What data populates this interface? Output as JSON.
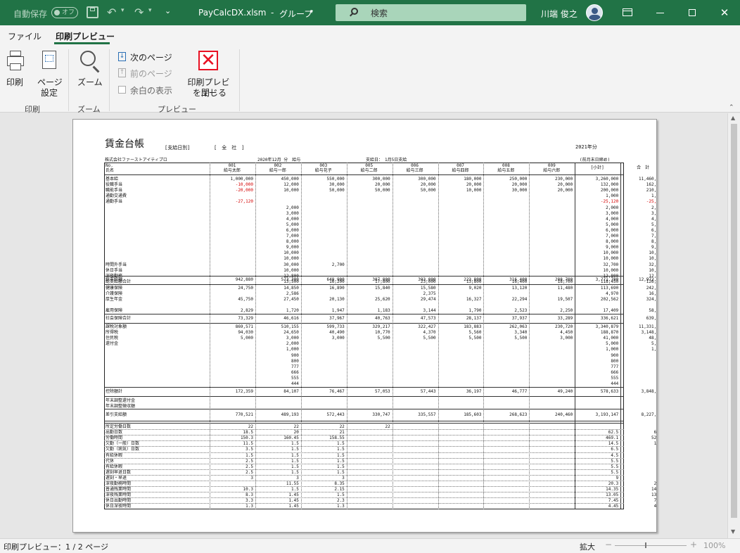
{
  "titlebar": {
    "autosave_label": "自動保存",
    "autosave_toggle": "オフ",
    "filename": "PayCalcDX.xlsm",
    "separator": "-",
    "group": "グループ",
    "search_placeholder": "検索",
    "user_name": "川端 俊之"
  },
  "tabs": [
    {
      "label": "ファイル"
    },
    {
      "label": "印刷プレビュー"
    }
  ],
  "ribbon": {
    "print": "印刷",
    "page_setup": [
      "ページ",
      "設定"
    ],
    "zoom": "ズーム",
    "next_page": "次のページ",
    "prev_page": "前のページ",
    "show_margins": "余白の表示",
    "close_preview": [
      "印刷プレビュー",
      "を閉じる"
    ],
    "groups": [
      "印刷",
      "ズーム",
      "プレビュー"
    ]
  },
  "status": {
    "text": "印刷プレビュー：1 / 2 ページ",
    "zoom_label": "拡大",
    "zoom_percent": "100%",
    "zoom_minus": "−",
    "zoom_plus": "+",
    "zoom_fraction": 0.42
  },
  "sheet": {
    "title": "賃金台帳",
    "mode": "[支給日別]",
    "scope": "[　全　社　]",
    "year": "2021年分",
    "company": "株式会社ファーストアイティプロ",
    "period": "2020年12月 分　給与",
    "pay_date": "支給日：　1月5日支給",
    "note": "(前月末日締め)",
    "hdr_no": "No.",
    "hdr_name": "氏名",
    "subtotal_label": "[小計]",
    "total_label": "合　計",
    "employees": [
      {
        "no": "001",
        "name": "給与太郎"
      },
      {
        "no": "002",
        "name": "給与一郎"
      },
      {
        "no": "003",
        "name": "給与花子"
      },
      {
        "no": "005",
        "name": "給与二郎"
      },
      {
        "no": "006",
        "name": "給与三郎"
      },
      {
        "no": "007",
        "name": "給与四郎"
      },
      {
        "no": "008",
        "name": "給与五郎"
      },
      {
        "no": "009",
        "name": "給与六郎"
      }
    ],
    "earn_labels": [
      "基本給",
      "役職手当",
      "職能手当",
      "通勤交通費",
      "通勤手当",
      "",
      "",
      "",
      "",
      "",
      "",
      "",
      "",
      "",
      "",
      "時間外手当",
      "休日手当",
      "深夜勤務",
      "総支給額合計"
    ],
    "earn_cols": [
      [
        "1,000,000",
        "-10,000",
        "-20,000",
        "",
        "-27,120",
        "",
        "",
        "",
        "",
        "",
        "",
        "",
        "",
        "",
        "",
        "",
        "",
        "",
        ""
      ],
      [
        "450,000",
        "12,000",
        "10,000",
        "",
        "",
        "2,000",
        "3,000",
        "4,000",
        "5,000",
        "6,000",
        "7,000",
        "8,000",
        "9,000",
        "10,000",
        "10,000",
        "30,000",
        "10,000",
        "12,800",
        "13,500"
      ],
      [
        "550,000",
        "30,000",
        "50,000",
        "",
        "",
        "",
        "",
        "",
        "",
        "",
        "",
        "",
        "",
        "",
        "",
        "2,700",
        "",
        "",
        "16,200"
      ],
      [
        "300,000",
        "20,000",
        "50,000",
        "",
        "",
        "",
        "",
        "",
        "",
        "",
        "",
        "",
        "",
        "",
        "",
        "",
        "",
        "",
        "17,800"
      ],
      [
        "300,000",
        "20,000",
        "50,000",
        "",
        "",
        "",
        "",
        "",
        "",
        "",
        "",
        "",
        "",
        "",
        "",
        "",
        "",
        "",
        "23,000"
      ],
      [
        "180,000",
        "20,000",
        "10,000",
        "",
        "",
        "",
        "",
        "",
        "",
        "",
        "",
        "",
        "",
        "",
        "",
        "",
        "",
        "",
        "13,800"
      ],
      [
        "250,000",
        "20,000",
        "30,000",
        "",
        "",
        "",
        "",
        "",
        "",
        "",
        "",
        "",
        "",
        "",
        "",
        "",
        "",
        "",
        "16,400"
      ],
      [
        "230,000",
        "20,000",
        "20,000",
        "",
        "",
        "",
        "",
        "",
        "",
        "",
        "",
        "",
        "",
        "",
        "",
        "",
        "",
        "",
        "18,700"
      ],
      [
        "3,260,000",
        "132,000",
        "200,000",
        "1,000",
        "-25,120",
        "2,000",
        "3,000",
        "4,000",
        "5,000",
        "6,000",
        "7,000",
        "8,000",
        "9,000",
        "10,000",
        "10,000",
        "32,700",
        "10,000",
        "12,800",
        "118,450"
      ],
      [
        "11,460,000",
        "162,000",
        "210,000",
        "1,000",
        "-25,120",
        "2,000",
        "3,000",
        "4,000",
        "5,000",
        "6,000",
        "7,000",
        "8,000",
        "9,000",
        "10,000",
        "10,000",
        "32,700",
        "10,000",
        "12,800",
        "126,350"
      ]
    ],
    "gross": {
      "label": "総支給額",
      "values": [
        "942,880",
        "573,300",
        "648,900",
        "387,800",
        "393,000",
        "223,800",
        "316,400",
        "288,700",
        "3,771,780",
        "12,972,730"
      ]
    },
    "ins_labels": [
      "健康保険",
      "介護保険",
      "厚生年金",
      "",
      "雇用保険"
    ],
    "ins_cols": [
      [
        "24,750",
        "",
        "45,750",
        "",
        "2,829"
      ],
      [
        "14,850",
        "2,586",
        "27,450",
        "",
        "1,720"
      ],
      [
        "16,890",
        "",
        "20,130",
        "",
        "1,947"
      ],
      [
        "15,840",
        "",
        "25,620",
        "",
        "1,183"
      ],
      [
        "15,580",
        "2,375",
        "29,474",
        "",
        "3,144"
      ],
      [
        "9,020",
        "",
        "16,327",
        "",
        "1,790"
      ],
      [
        "13,120",
        "",
        "22,294",
        "",
        "2,523"
      ],
      [
        "11,480",
        "",
        "19,507",
        "",
        "2,250"
      ],
      [
        "113,690",
        "4,970",
        "202,562",
        "",
        "17,409"
      ],
      [
        "242,890",
        "16,375",
        "324,824",
        "",
        "58,884"
      ]
    ],
    "social": {
      "label": "社会保険合計",
      "values": [
        "73,329",
        "46,616",
        "37,967",
        "40,763",
        "47,573",
        "28,137",
        "37,937",
        "33,289",
        "336,621",
        "639,974"
      ]
    },
    "tax_labels": [
      "課税対象額",
      "所得税",
      "住民税",
      "還付金",
      "",
      "",
      "",
      "",
      "",
      "",
      ""
    ],
    "tax_cols": [
      [
        "869,571",
        "94,030",
        "5,000",
        "",
        "",
        "",
        "",
        "",
        "",
        "",
        ""
      ],
      [
        "510,155",
        "24,650",
        "3,000",
        "2,000",
        "1,000",
        "900",
        "800",
        "777",
        "666",
        "555",
        "444"
      ],
      [
        "599,733",
        "40,490",
        "3,000",
        "",
        "",
        "",
        "",
        "",
        "",
        "",
        ""
      ],
      [
        "329,217",
        "10,770",
        "5,500",
        "",
        "",
        "",
        "",
        "",
        "",
        "",
        ""
      ],
      [
        "322,427",
        "4,370",
        "5,500",
        "",
        "",
        "",
        "",
        "",
        "",
        "",
        ""
      ],
      [
        "183,883",
        "5,560",
        "5,500",
        "",
        "",
        "",
        "",
        "",
        "",
        "",
        ""
      ],
      [
        "262,063",
        "3,340",
        "5,500",
        "",
        "",
        "",
        "",
        "",
        "",
        "",
        ""
      ],
      [
        "230,720",
        "4,450",
        "3,000",
        "",
        "",
        "",
        "",
        "",
        "",
        "",
        ""
      ],
      [
        "3,340,879",
        "188,870",
        "41,000",
        "5,000",
        "1,000",
        "900",
        "800",
        "777",
        "666",
        "555",
        "444"
      ],
      [
        "11,331,526",
        "3,148,971",
        "48,500",
        "5,000",
        "1,000",
        "900",
        "800",
        "777",
        "666",
        "555",
        "444"
      ]
    ],
    "deduct": {
      "label": "控除額計",
      "values": [
        "172,359",
        "84,107",
        "76,467",
        "57,053",
        "57,443",
        "36,197",
        "46,777",
        "49,240",
        "578,633",
        "3,848,567"
      ]
    },
    "adj_labels": [
      "年末調整還付金",
      "年末調整徴収額"
    ],
    "net": {
      "label": "差引支給額",
      "values": [
        "770,521",
        "489,193",
        "572,443",
        "330,747",
        "335,557",
        "185,603",
        "268,623",
        "240,460",
        "3,193,147",
        "8,227,943"
      ]
    },
    "att_labels": [
      "所定労働日数",
      "出勤日数",
      "労働時間",
      "欠勤（一般）日数",
      "欠勤（病気）日数",
      "有給休暇",
      "代休",
      "有給休暇",
      "遅刻早退日数",
      "遅刻・早退",
      "深夜勤務時間",
      "普通残業時間",
      "深夜残業時間",
      "休日出勤時間",
      "休日深夜時間"
    ],
    "att_cols": [
      [
        "22",
        "18.5",
        "150.3",
        "11.5",
        "3.5",
        "1.5",
        "2.5",
        "2.5",
        "2.5",
        "3",
        "",
        "10.3",
        "8.3",
        "3.3",
        "1.3"
      ],
      [
        "22",
        "20",
        "160.45",
        "1.5",
        "1.5",
        "1.5",
        "1.5",
        "1.5",
        "1.5",
        "3",
        "11.55",
        "1.5",
        "1.45",
        "1.45",
        "1.45"
      ],
      [
        "22",
        "21",
        "158.55",
        "1.5",
        "1.5",
        "1.5",
        "1.5",
        "1.5",
        "1.5",
        "3",
        "8.35",
        "2.15",
        "1.5",
        "2.3",
        "1.3"
      ],
      [
        "22",
        "",
        "",
        "",
        "",
        "",
        "",
        "",
        "",
        "",
        "",
        "",
        "",
        "",
        ""
      ],
      [
        "",
        "",
        "",
        "",
        "",
        "",
        "",
        "",
        "",
        "",
        "",
        "",
        "",
        "",
        ""
      ],
      [
        "",
        "",
        "",
        "",
        "",
        "",
        "",
        "",
        "",
        "",
        "",
        "",
        "",
        "",
        ""
      ],
      [
        "",
        "",
        "",
        "",
        "",
        "",
        "",
        "",
        "",
        "",
        "",
        "",
        "",
        "",
        ""
      ],
      [
        "",
        "",
        "",
        "",
        "",
        "",
        "",
        "",
        "",
        "",
        "",
        "",
        "",
        "",
        ""
      ],
      [
        "",
        "62.5",
        "469.1",
        "14.5",
        "6.5",
        "4.5",
        "5.5",
        "5.5",
        "5.5",
        "9",
        "20.3",
        "14.35",
        "13.05",
        "7.45",
        "4.45"
      ],
      [
        "",
        "62.5",
        "525.1",
        "14.5",
        "6.5",
        "4.5",
        "5.5",
        "5.5",
        "5.5",
        "9",
        "20.3",
        "14.35",
        "13.05",
        "7.45",
        "4.45"
      ]
    ]
  },
  "colors": {
    "excel_green": "#217346",
    "search_bg": "#a9d5ba",
    "close_red": "#e81123",
    "negative": "#d40000"
  }
}
